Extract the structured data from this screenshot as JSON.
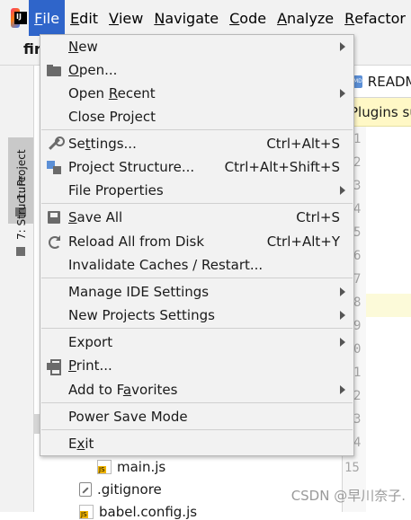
{
  "menubar": {
    "items": [
      "File",
      "Edit",
      "View",
      "Navigate",
      "Code",
      "Analyze",
      "Refactor"
    ],
    "active": "File"
  },
  "tabrow": {
    "project_name": "firs"
  },
  "toolstrip": {
    "project_label": "1: Project",
    "structure_label": "7: Structure"
  },
  "editor": {
    "tab_label": "READM",
    "banner_text": "Plugins su",
    "line_numbers": [
      "1",
      "2",
      "3",
      "4",
      "5",
      "6",
      "7",
      "8",
      "9",
      "0",
      "1",
      "2",
      "3",
      "4",
      "15"
    ]
  },
  "tree": {
    "items": [
      {
        "label": "main.js",
        "icon": "js-file-icon"
      },
      {
        "label": ".gitignore",
        "icon": "git-ignore-file-icon"
      },
      {
        "label": "babel.config.js",
        "icon": "js-file-icon"
      }
    ]
  },
  "file_menu": {
    "items": [
      {
        "label": "New",
        "underline": "N",
        "shortcut": "",
        "submenu": true,
        "icon": ""
      },
      {
        "label": "Open...",
        "underline": "O",
        "shortcut": "",
        "submenu": false,
        "icon": "folder-icon"
      },
      {
        "label": "Open Recent",
        "underline": "R",
        "shortcut": "",
        "submenu": true,
        "icon": ""
      },
      {
        "label": "Close Project",
        "underline": "",
        "shortcut": "",
        "submenu": false,
        "icon": ""
      },
      {
        "label": "Settings...",
        "underline": "t",
        "shortcut": "Ctrl+Alt+S",
        "submenu": false,
        "icon": "wrench-icon"
      },
      {
        "label": "Project Structure...",
        "underline": "",
        "shortcut": "Ctrl+Alt+Shift+S",
        "submenu": false,
        "icon": "structure-icon"
      },
      {
        "label": "File Properties",
        "underline": "",
        "shortcut": "",
        "submenu": true,
        "icon": ""
      },
      {
        "label": "Save All",
        "underline": "S",
        "shortcut": "Ctrl+S",
        "submenu": false,
        "icon": "save-icon"
      },
      {
        "label": "Reload All from Disk",
        "underline": "",
        "shortcut": "Ctrl+Alt+Y",
        "submenu": false,
        "icon": "reload-icon"
      },
      {
        "label": "Invalidate Caches / Restart...",
        "underline": "",
        "shortcut": "",
        "submenu": false,
        "icon": ""
      },
      {
        "label": "Manage IDE Settings",
        "underline": "",
        "shortcut": "",
        "submenu": true,
        "icon": ""
      },
      {
        "label": "New Projects Settings",
        "underline": "",
        "shortcut": "",
        "submenu": true,
        "icon": ""
      },
      {
        "label": "Export",
        "underline": "",
        "shortcut": "",
        "submenu": true,
        "icon": ""
      },
      {
        "label": "Print...",
        "underline": "P",
        "shortcut": "",
        "submenu": false,
        "icon": "print-icon"
      },
      {
        "label": "Add to Favorites",
        "underline": "a",
        "shortcut": "",
        "submenu": true,
        "icon": ""
      },
      {
        "label": "Power Save Mode",
        "underline": "",
        "shortcut": "",
        "submenu": false,
        "icon": ""
      },
      {
        "label": "Exit",
        "underline": "x",
        "shortcut": "",
        "submenu": false,
        "icon": ""
      }
    ]
  },
  "watermark": "CSDN @早川奈子."
}
